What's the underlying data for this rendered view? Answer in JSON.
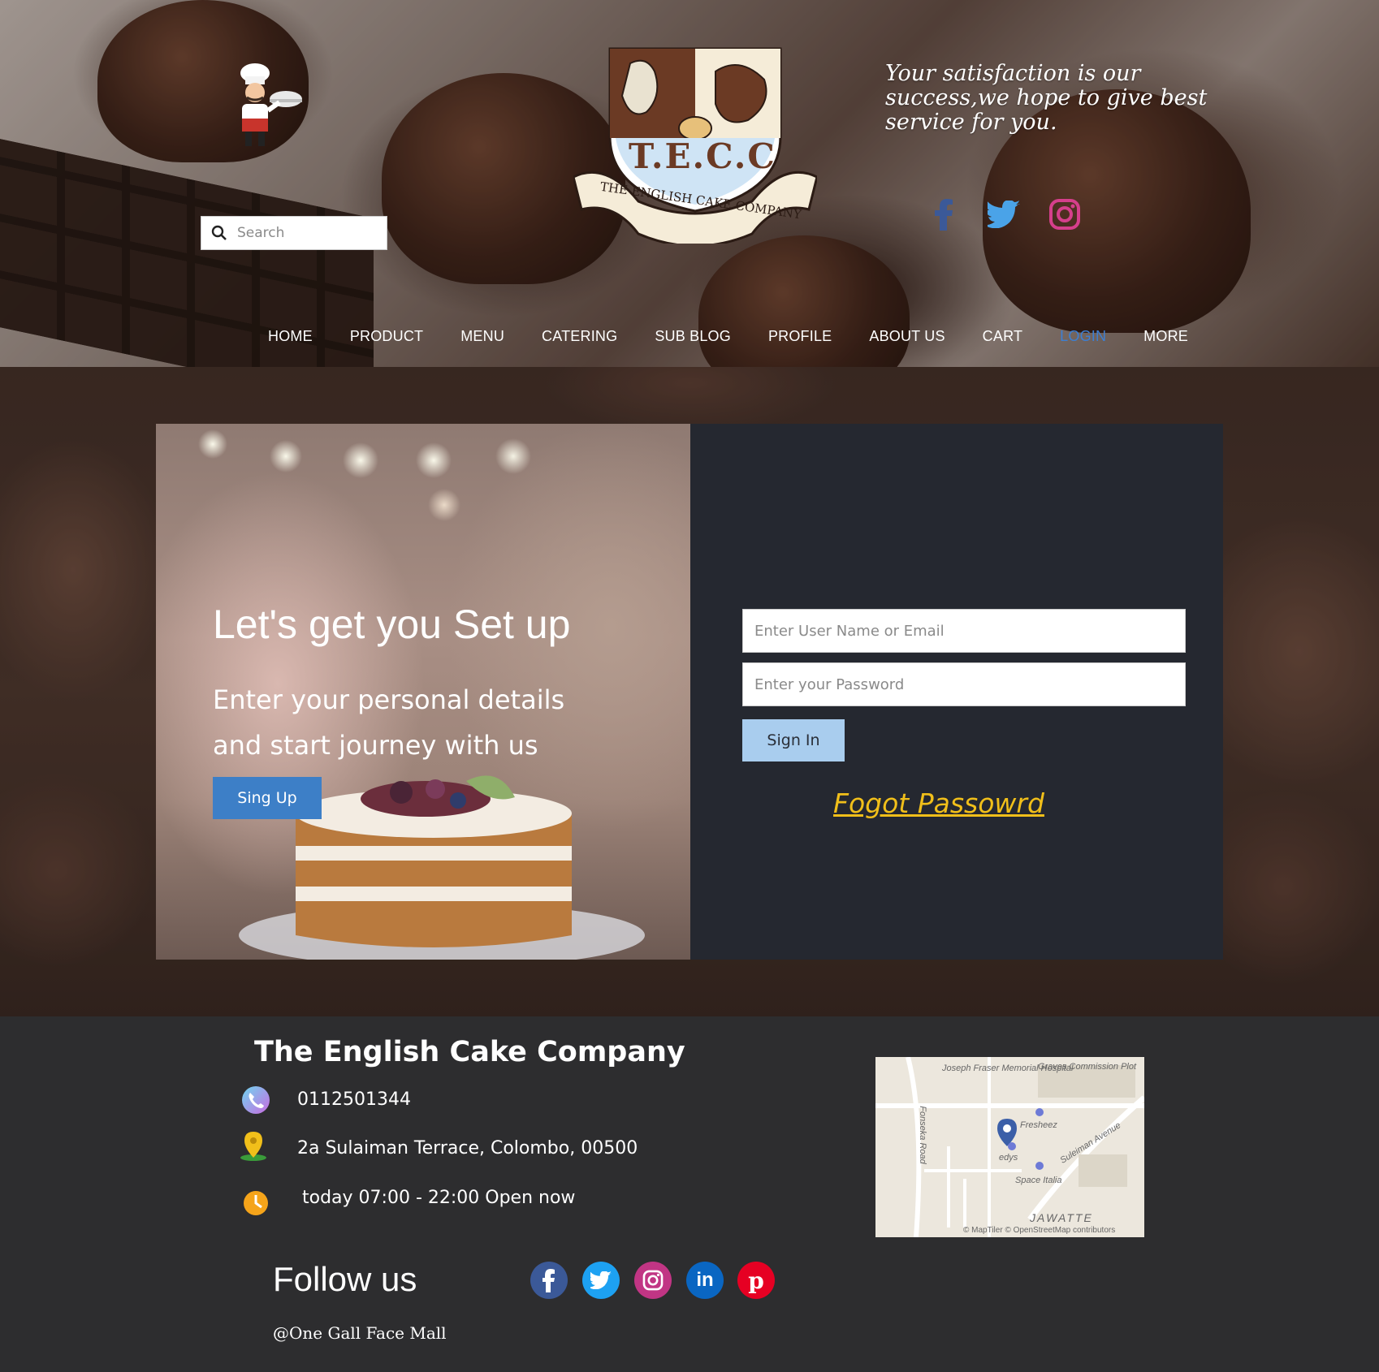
{
  "header": {
    "search_placeholder": "Search",
    "logo_initials": "T.E.C.C",
    "logo_banner": "THE ENGLISH CAKE COMPANY",
    "tagline": "Your satisfaction is our success,we hope to give best service for you.",
    "social_icons": [
      "facebook-icon",
      "twitter-icon",
      "instagram-icon"
    ]
  },
  "nav": {
    "items": [
      {
        "label": "HOME"
      },
      {
        "label": "PRODUCT"
      },
      {
        "label": "MENU"
      },
      {
        "label": "CATERING"
      },
      {
        "label": "SUB BLOG"
      },
      {
        "label": "PROFILE"
      },
      {
        "label": "ABOUT US"
      },
      {
        "label": "CART"
      },
      {
        "label": "LOGIN",
        "active": true
      },
      {
        "label": "MORE"
      }
    ],
    "active_color": "#3d7fd2"
  },
  "signup_panel": {
    "title": "Let's get you Set up",
    "subtitle": "Enter your personal details and start journey with us",
    "button_label": "Sing Up",
    "button_color": "#3d7fc7"
  },
  "login_panel": {
    "username_placeholder": "Enter User Name or Email",
    "password_placeholder": "Enter your Password",
    "signin_label": "Sign In",
    "signin_color": "#a9cdee",
    "forgot_label": "Fogot Passowrd",
    "forgot_color": "#f1bf1a"
  },
  "footer": {
    "company_name": "The English Cake Company",
    "phone": "0112501344",
    "address": "2a Sulaiman Terrace, Colombo, 00500",
    "hours": "today 07:00 - 22:00 Open now",
    "follow_label": "Follow us",
    "handle": "@One Gall Face Mall",
    "social_icons": [
      "facebook-icon",
      "twitter-icon",
      "instagram-icon",
      "linkedin-icon",
      "pinterest-icon"
    ],
    "map": {
      "labels": [
        "Joseph Fraser Memorial Hospital",
        "Graves Commission Plot",
        "Fonseka Road",
        "Fresheez",
        "Suleiman Avenue",
        "edys",
        "Space Italia",
        "JAWATTE"
      ],
      "attribution": "© MapTiler © OpenStreetMap contributors"
    }
  }
}
